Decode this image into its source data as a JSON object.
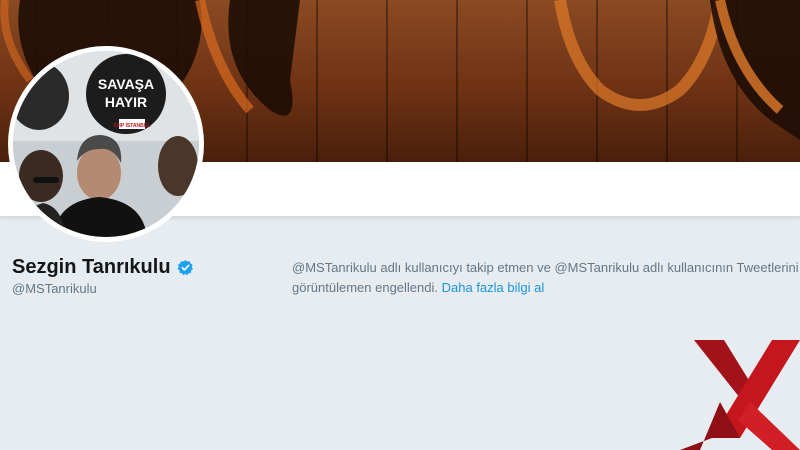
{
  "profile": {
    "display_name": "Sezgin Tanrıkulu",
    "handle": "@MSTanrikulu",
    "verified": true
  },
  "block_notice": {
    "line1": "@MSTanrikulu adlı kullanıcıyı takip etmen ve @MSTanrikulu adlı kullanıcının Tweetlerini",
    "line2": "görüntülemen engellendi.",
    "learn_more": "Daha fazla bilgi al"
  },
  "avatar": {
    "sign1": "SAVAŞA",
    "sign2": "HAYIR",
    "sign_small": "CHP İSTANBUL"
  },
  "colors": {
    "link": "#1b95e0",
    "verified": "#1da1f2",
    "page_bg": "#e6ecf0",
    "watermark": "#c4161c"
  },
  "icons": {
    "verified": "verified-badge-icon",
    "watermark": "x-logo-icon"
  }
}
